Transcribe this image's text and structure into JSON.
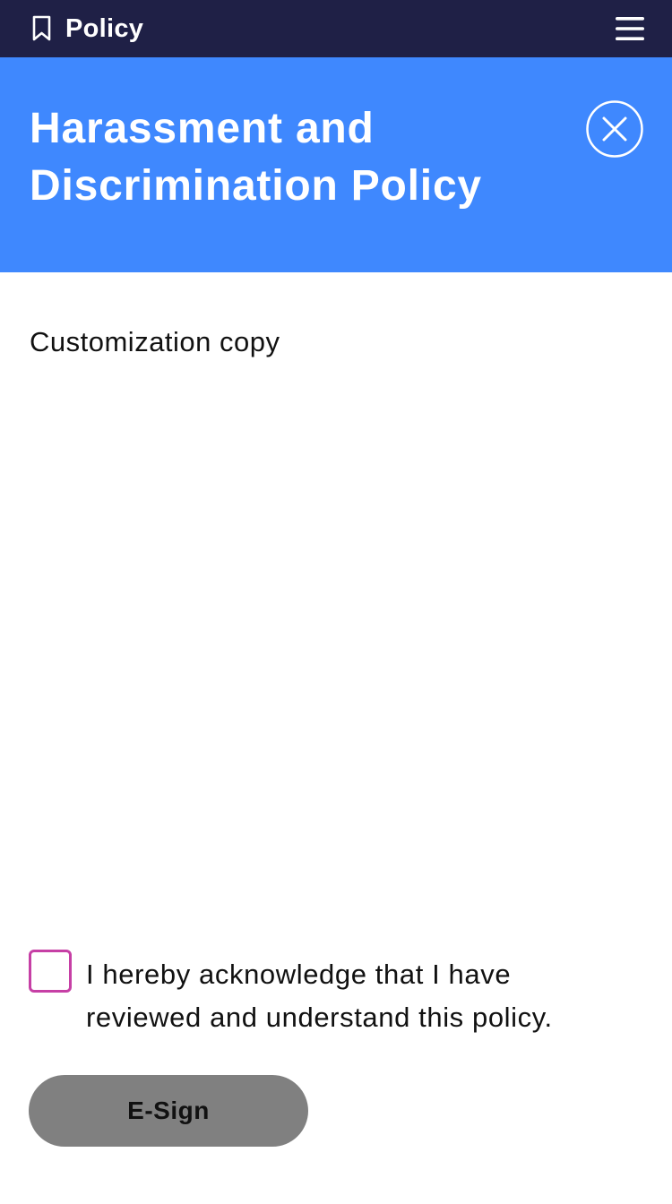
{
  "topbar": {
    "icon": "bookmark-icon",
    "title": "Policy",
    "menu_icon": "hamburger-menu-icon",
    "background": "#1f2046"
  },
  "header": {
    "title": "Harassment and Discrimination Policy",
    "close_icon": "close-circle-icon",
    "background": "#3f88fe"
  },
  "content": {
    "body_text": "Customization copy"
  },
  "acknowledgement": {
    "checked": false,
    "label": "I hereby acknowledge that I have reviewed and understand this policy.",
    "checkbox_border_color": "#c63fa5"
  },
  "actions": {
    "esign_label": "E-Sign",
    "esign_background": "#808080"
  }
}
